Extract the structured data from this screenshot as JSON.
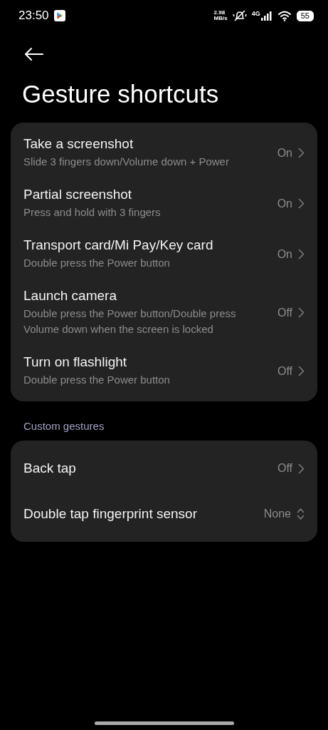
{
  "status_bar": {
    "time": "23:50",
    "net_speed": "2.98",
    "net_unit": "MB/s",
    "network": "4G",
    "battery": "55"
  },
  "title": "Gesture shortcuts",
  "sections": [
    {
      "items": [
        {
          "kind": "link",
          "title": "Take a screenshot",
          "subtitle": "Slide 3 fingers down/Volume down + Power",
          "value": "On"
        },
        {
          "kind": "link",
          "title": "Partial screenshot",
          "subtitle": "Press and hold with 3 fingers",
          "value": "On"
        },
        {
          "kind": "link",
          "title": "Transport card/Mi Pay/Key card",
          "subtitle": "Double press the Power button",
          "value": "On"
        },
        {
          "kind": "link",
          "title": "Launch camera",
          "subtitle": "Double press the Power button/Double press Volume down when the screen is locked",
          "value": "Off"
        },
        {
          "kind": "link",
          "title": "Turn on flashlight",
          "subtitle": "Double press the Power button",
          "value": "Off"
        }
      ]
    },
    {
      "header": "Custom gestures",
      "items": [
        {
          "kind": "link",
          "title": "Back tap",
          "value": "Off"
        },
        {
          "kind": "dropdown",
          "title": "Double tap fingerprint sensor",
          "value": "None"
        }
      ]
    }
  ]
}
